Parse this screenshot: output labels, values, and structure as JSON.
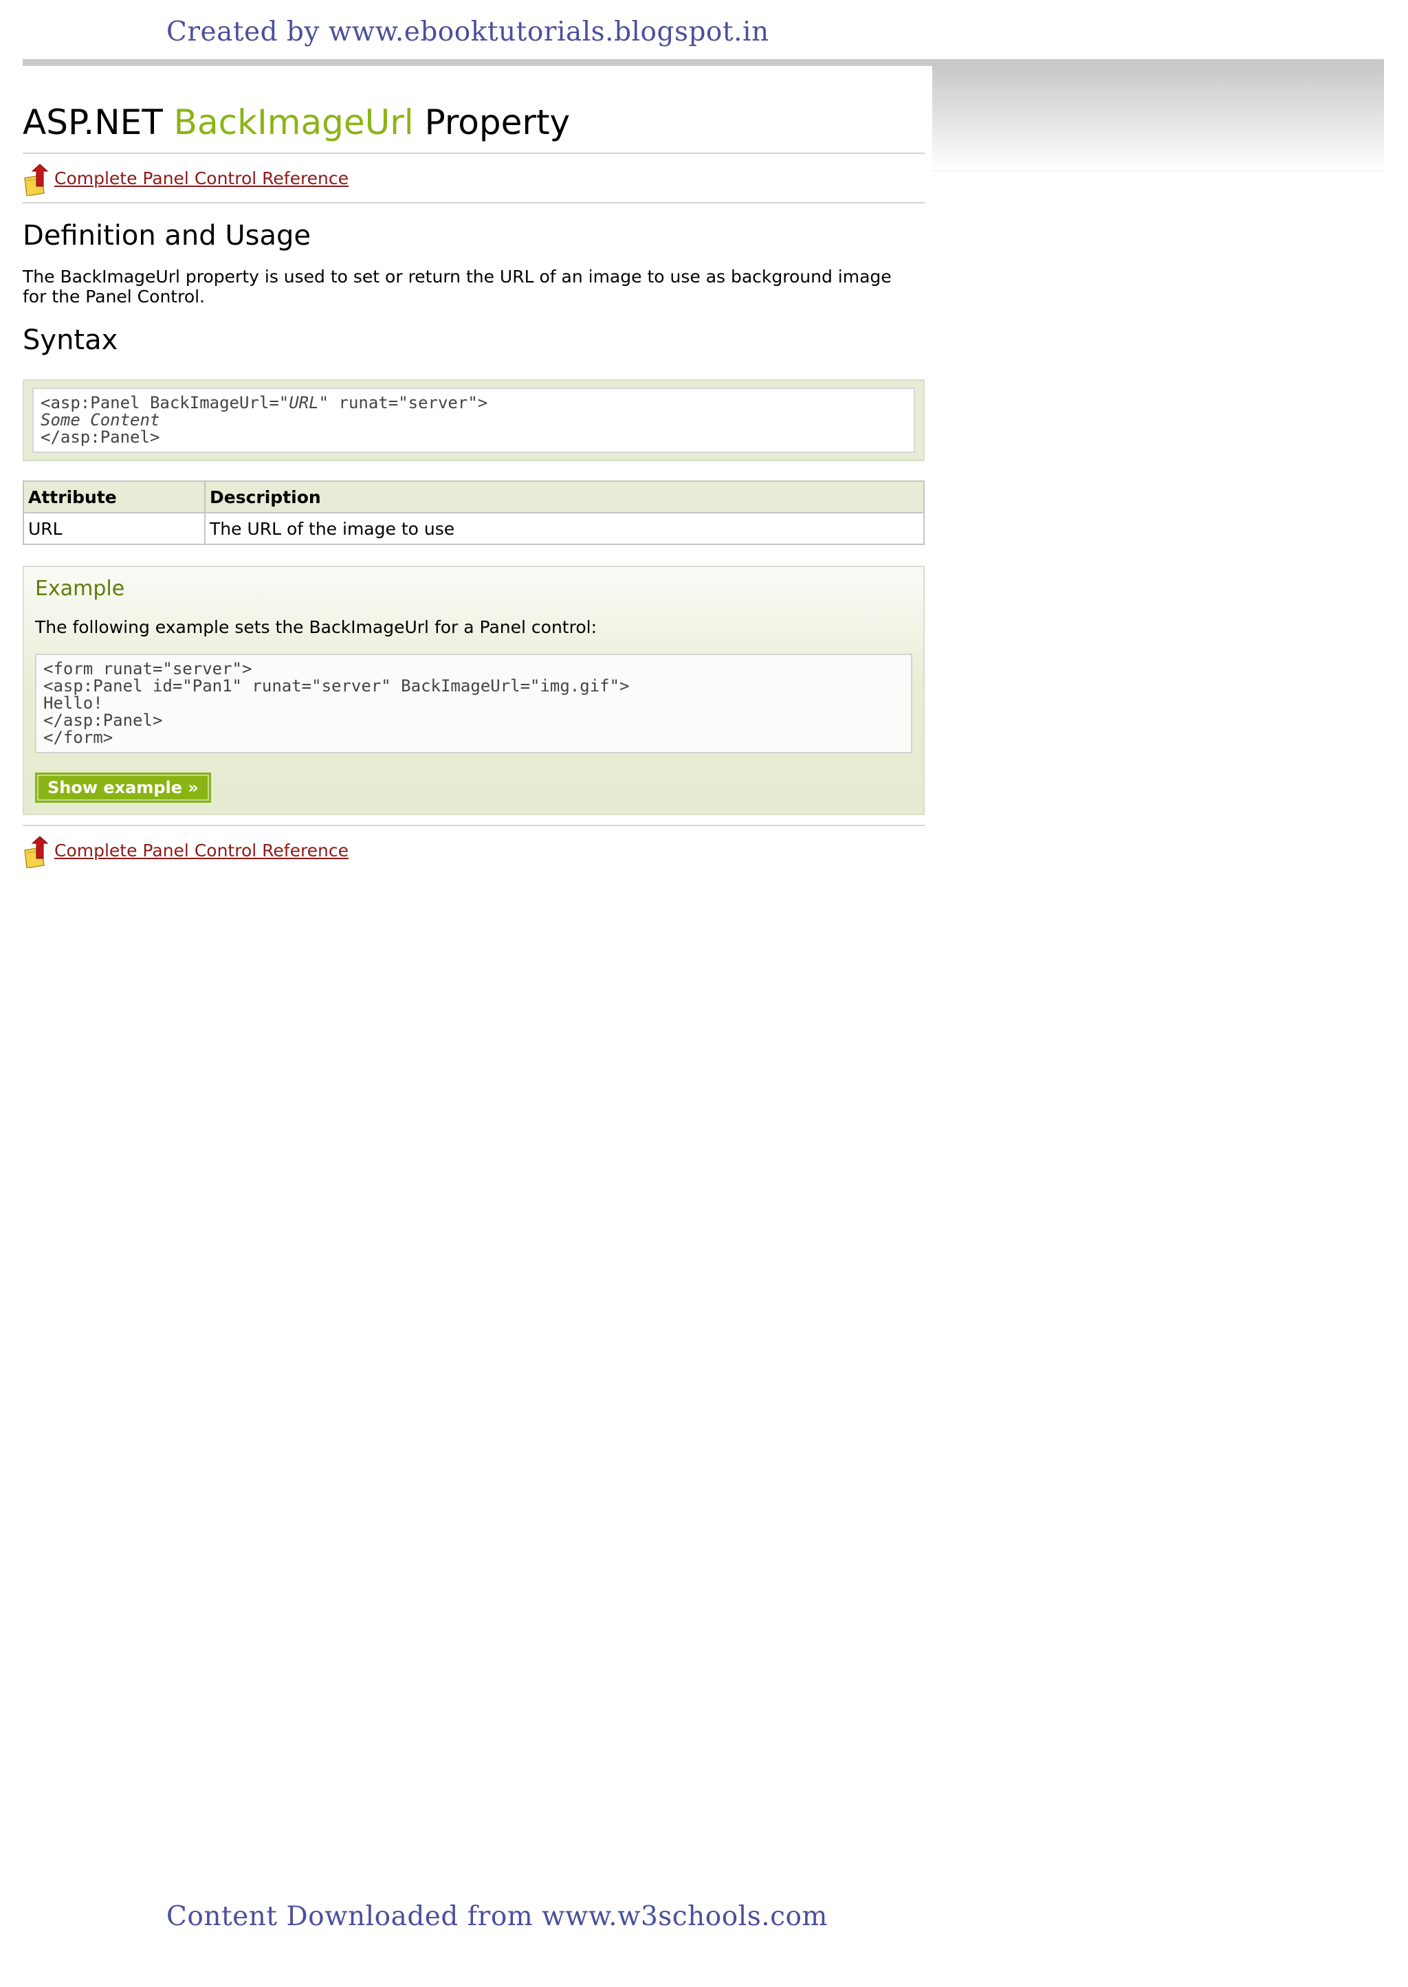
{
  "header_credit": "Created by www.ebooktutorials.blogspot.in",
  "footer_credit": "Content Downloaded from www.w3schools.com",
  "title": {
    "prefix": "ASP.NET ",
    "accent": "BackImageUrl",
    "suffix": " Property"
  },
  "reference_link": "Complete Panel Control Reference",
  "definition": {
    "heading": "Definition and Usage",
    "text": "The BackImageUrl property is used to set or return the URL of an image to use as background image for the Panel Control."
  },
  "syntax": {
    "heading": "Syntax",
    "line1_start": "<asp:Panel BackImageUrl=\"",
    "line1_italic": "URL",
    "line1_end": "\" runat=\"server\">",
    "line2": "Some Content",
    "line3": "</asp:Panel>"
  },
  "attributes_table": {
    "headers": [
      "Attribute",
      "Description"
    ],
    "rows": [
      [
        "URL",
        "The URL of the image to use"
      ]
    ]
  },
  "example": {
    "heading": "Example",
    "text": "The following example sets the BackImageUrl for a Panel control:",
    "code": "<form runat=\"server\">\n<asp:Panel id=\"Pan1\" runat=\"server\" BackImageUrl=\"img.gif\">\nHello!\n</asp:Panel>\n</form>",
    "button": "Show example »"
  },
  "colors": {
    "accent": "#8ab414",
    "link": "#8e1a1a",
    "credit": "#4b4f9c"
  },
  "icons": [
    "folder-up-arrow-icon"
  ]
}
